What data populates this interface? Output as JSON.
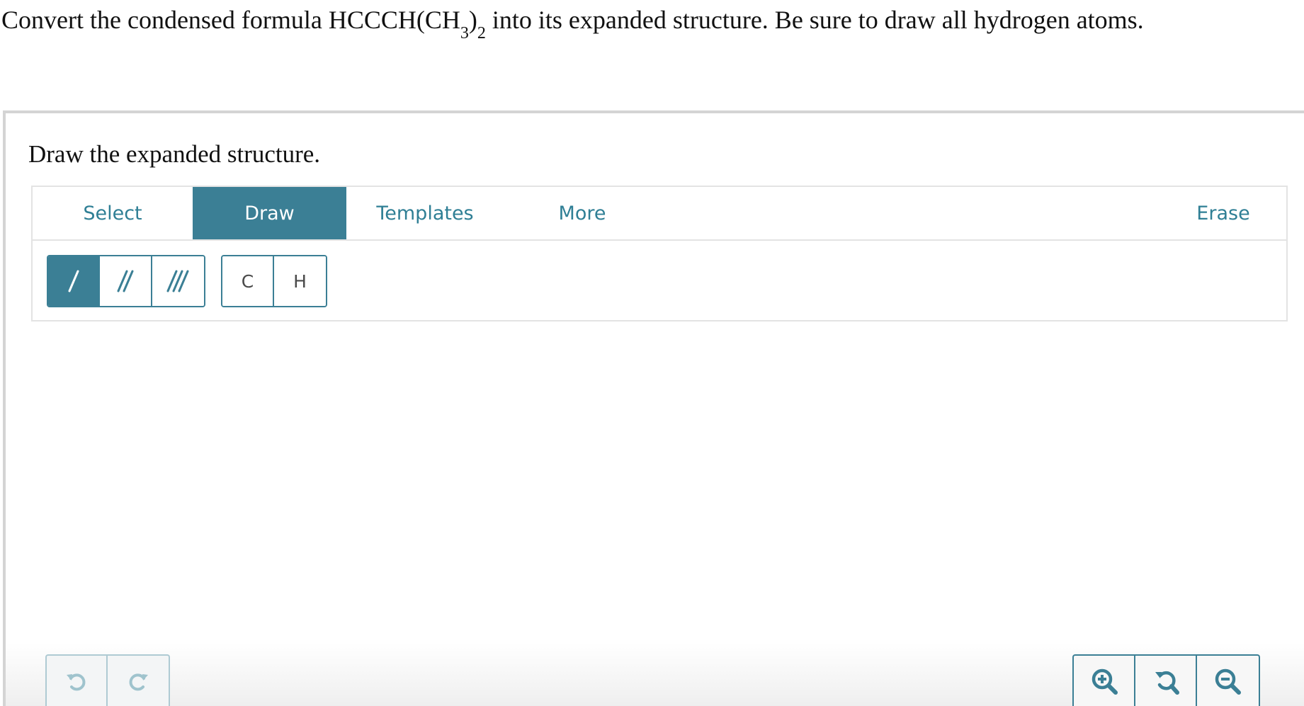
{
  "question": {
    "prefix": "Convert the condensed formula HCCCH(CH",
    "sub1": "3",
    "close": ")",
    "sub2": "2",
    "suffix": " into its expanded structure. Be sure to draw all hydrogen atoms."
  },
  "prompt": "Draw the expanded structure.",
  "tabs": {
    "select": "Select",
    "draw": "Draw",
    "templates": "Templates",
    "more": "More",
    "erase": "Erase"
  },
  "active_tab": "Draw",
  "atoms": {
    "carbon": "C",
    "hydrogen": "H"
  },
  "bond_tools": [
    "single-bond-icon",
    "double-bond-icon",
    "triple-bond-icon"
  ],
  "selected_bond": "single",
  "icons": {
    "undo": "undo-icon",
    "redo": "redo-icon",
    "zoom_in": "zoom-in-icon",
    "zoom_reset": "zoom-reset-icon",
    "zoom_out": "zoom-out-icon"
  },
  "colors": {
    "accent": "#3b7f95",
    "tab_text": "#2f7f95",
    "border": "#e3e3e3"
  }
}
